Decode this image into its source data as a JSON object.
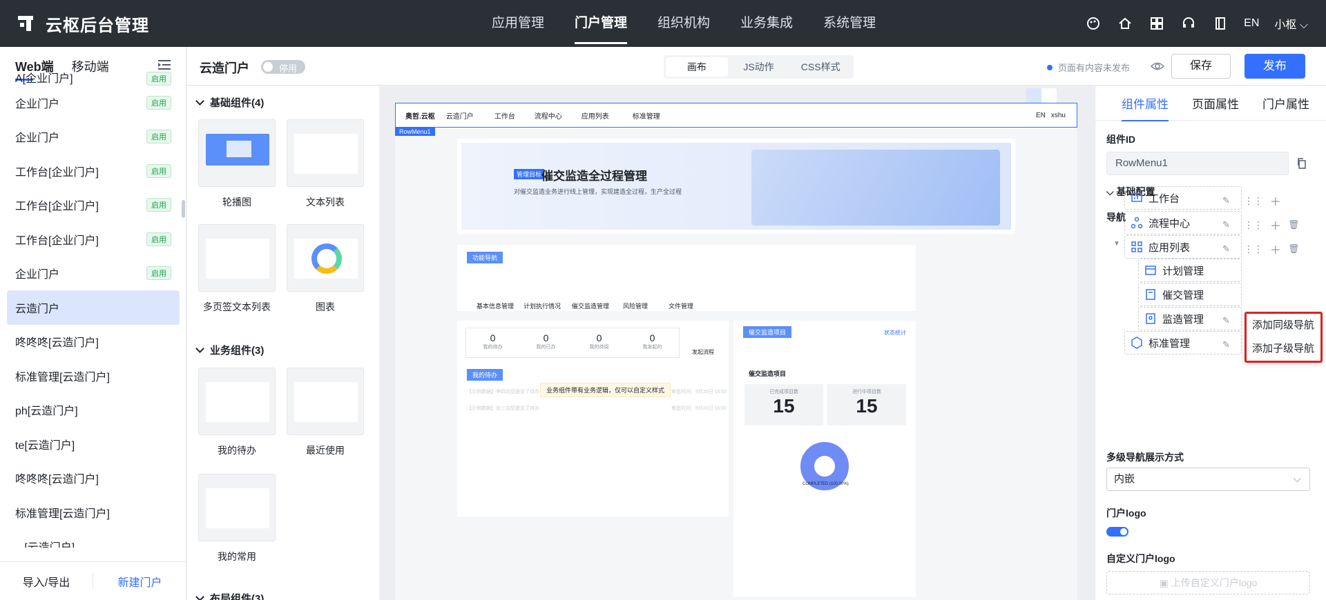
{
  "app": {
    "title": "云枢后台管理"
  },
  "topnav": {
    "items": [
      "应用管理",
      "门户管理",
      "组织机构",
      "业务集成",
      "系统管理"
    ],
    "active": "门户管理"
  },
  "topbar_right": {
    "lang": "EN",
    "user": "小枢"
  },
  "left": {
    "tabs": [
      "Web端",
      "移动端"
    ],
    "items": [
      {
        "label": "A[企业门户]",
        "status": "启用"
      },
      {
        "label": "企业门户",
        "status": "启用"
      },
      {
        "label": "企业门户",
        "status": "启用"
      },
      {
        "label": "工作台[企业门户]",
        "status": "启用"
      },
      {
        "label": "工作台[企业门户]",
        "status": "启用"
      },
      {
        "label": "工作台[企业门户]",
        "status": "启用"
      },
      {
        "label": "企业门户",
        "status": "启用"
      },
      {
        "label": "云造门户",
        "status": ""
      },
      {
        "label": "咚咚咚[云造门户]",
        "status": ""
      },
      {
        "label": "标准管理[云造门户]",
        "status": ""
      },
      {
        "label": "ph[云造门户]",
        "status": ""
      },
      {
        "label": "te[云造门户]",
        "status": ""
      },
      {
        "label": "咚咚咚[云造门户]",
        "status": ""
      },
      {
        "label": "标准管理[云造门户]",
        "status": ""
      },
      {
        "label": "...[云造门户]",
        "status": ""
      }
    ],
    "footer": {
      "import_export": "导入/导出",
      "new_portal": "新建门户"
    }
  },
  "toolbar": {
    "title": "云造门户",
    "toggle_label": "停用",
    "segments": [
      "画布",
      "JS动作",
      "CSS样式"
    ],
    "unpublished": "页面有内容未发布",
    "save": "保存",
    "publish": "发布"
  },
  "components": {
    "basic": {
      "title": "基础组件(4)",
      "cards": [
        "轮播图",
        "文本列表",
        "多页签文本列表",
        "图表"
      ]
    },
    "business": {
      "title": "业务组件(3)",
      "cards": [
        "我的待办",
        "最近使用",
        "我的常用"
      ]
    },
    "layout": {
      "title": "布局组件(3)"
    }
  },
  "preview": {
    "brand": "奥哲.云枢",
    "portal": "云造门户",
    "nav": [
      "工作台",
      "流程中心",
      "应用列表",
      "标准管理"
    ],
    "lang": "EN",
    "user": "xshu",
    "tag": "RowMenu1",
    "banner_badge": "管理目标",
    "banner_title": "催交监造全过程管理",
    "banner_sub": "对催交监造业务进行线上管理，实现建造全过程，生产全过程",
    "func_nav_tag": "功能导航",
    "func_items": [
      "基本信息管理",
      "计划执行情况",
      "催交监造管理",
      "风险管理",
      "文件管理"
    ],
    "stats": [
      {
        "value": "0",
        "label": "我的待办"
      },
      {
        "value": "0",
        "label": "我的已办"
      },
      {
        "value": "0",
        "label": "我的待阅"
      },
      {
        "value": "0",
        "label": "我发起的"
      }
    ],
    "launch": "发起流程",
    "my_todo_tag": "我的待办",
    "todo_rows": [
      "【示例数据】李四向您提交了待办",
      "【示例数据】张三向您提交了待办"
    ],
    "todo_times": [
      "审批时间：9月20日 16:00",
      "审批时间：9月20日 16:00"
    ],
    "tooltip": "业务组件带有业务逻辑，仅可以自定义样式",
    "side_tag": "催交监造项目",
    "side_link": "状态统计",
    "side_sub": "催交监造项目",
    "kpi": [
      {
        "label": "已完成项目数",
        "value": "15"
      },
      {
        "label": "进行中项目数",
        "value": "15"
      }
    ],
    "donut_label": "COMPLETED (100.00%)"
  },
  "right": {
    "tabs": [
      "组件属性",
      "页面属性",
      "门户属性"
    ],
    "id_label": "组件ID",
    "id_value": "RowMenu1",
    "basic_config": "基础配置",
    "nav_label": "导航",
    "nav_items": [
      {
        "label": "工作台",
        "icon": "dashboard-icon"
      },
      {
        "label": "流程中心",
        "icon": "flow-icon"
      },
      {
        "label": "应用列表",
        "icon": "grid-icon"
      },
      {
        "label": "计划管理",
        "icon": "plan-icon"
      },
      {
        "label": "催交管理",
        "icon": "urge-icon"
      },
      {
        "label": "监造管理",
        "icon": "monitor-icon"
      },
      {
        "label": "标准管理",
        "icon": "cube-icon"
      }
    ],
    "multi_nav_label": "多级导航展示方式",
    "multi_nav_value": "内嵌",
    "logo_label": "门户logo",
    "logo_enabled": true,
    "custom_logo_label": "自定义门户logo",
    "upload_label": "上传自定义门户logo"
  },
  "popup": {
    "items": [
      "添加同级导航",
      "添加子级导航"
    ]
  },
  "colors": {
    "primary": "#3370ff",
    "topbar": "#2b2f36",
    "highlight": "#e02020"
  }
}
